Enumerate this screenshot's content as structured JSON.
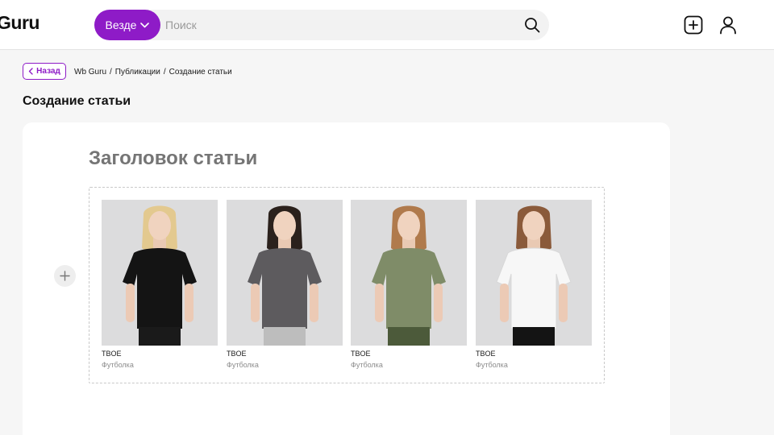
{
  "header": {
    "logo": "Guru",
    "search_scope": "Везде",
    "search_placeholder": "Поиск"
  },
  "page": {
    "back_label": "Назад",
    "breadcrumbs": [
      "Wb Guru",
      "Публикации",
      "Создание статьи"
    ],
    "breadcrumb_separator": "/",
    "title": "Создание статьи"
  },
  "editor": {
    "title_placeholder": "Заголовок статьи",
    "products": [
      {
        "brand": "TBOE",
        "name": "Футболка",
        "color": "black",
        "shirt_hex": "#141414"
      },
      {
        "brand": "TBOE",
        "name": "Футболка",
        "color": "graphite",
        "shirt_hex": "#5d5b5e"
      },
      {
        "brand": "TBOE",
        "name": "Футболка",
        "color": "olive",
        "shirt_hex": "#7f8c68"
      },
      {
        "brand": "TBOE",
        "name": "Футболка",
        "color": "white",
        "shirt_hex": "#f7f7f7"
      }
    ]
  },
  "colors": {
    "accent": "#8e1bc7",
    "page_bg": "#f6f6f6",
    "card_bg": "#ffffff"
  },
  "icons": [
    "chevron-down-icon",
    "search-icon",
    "add-publication-icon",
    "user-icon",
    "chevron-left-icon",
    "plus-icon"
  ]
}
